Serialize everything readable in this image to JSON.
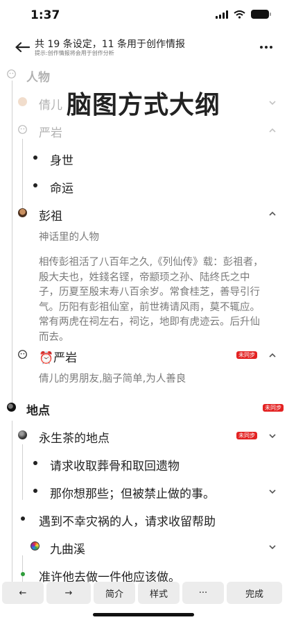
{
  "status": {
    "time": "1:37"
  },
  "header": {
    "title": "共 19 条设定，11 条用于创作情报",
    "subtitle": "提示:创作情报将会用于创作分析"
  },
  "overlay": {
    "title": "脑图方式大纲"
  },
  "outline": {
    "root": "人物",
    "n_qianer": "倩儿",
    "n_yanyan1": "严岩",
    "n_shenshi": "身世",
    "n_mingyun": "命运",
    "n_pengzu": "彭祖",
    "pengzu_note1": "神话里的人物",
    "pengzu_note2": "相传彭祖活了八百年之久,《列仙传》载：彭祖者，殷大夫也，姓錢名铿，帝颛顼之孙、陆终氏之中子，历夏至殷末寿八百余岁。常食桂芝，善导引行气。历阳有彭祖仙室，前世祷请风雨，莫不辄应。常有两虎在祠左右，祠讫，地即有虎迹云。后升仙而去。",
    "n_yanyan2": "⏰严岩",
    "yanyan2_note": "倩儿的男朋友,脑子简单,为人善良",
    "n_didian": "地点",
    "n_yongsheng": "永生茶的地点",
    "n_qingqiu": "请求收取葬骨和取回遗物",
    "n_nini": "那你想那些；但被禁止做的事。",
    "n_yudao": "遇到不幸灾祸的人，请求收留帮助",
    "n_jiuqu": "九曲溪",
    "n_zhunxu": "准许他去做一件他应该做。",
    "badge": "未同步"
  },
  "toolbar": {
    "prev": "←",
    "next": "→",
    "intro": "简介",
    "style": "样式",
    "more": "···",
    "done": "完成"
  }
}
